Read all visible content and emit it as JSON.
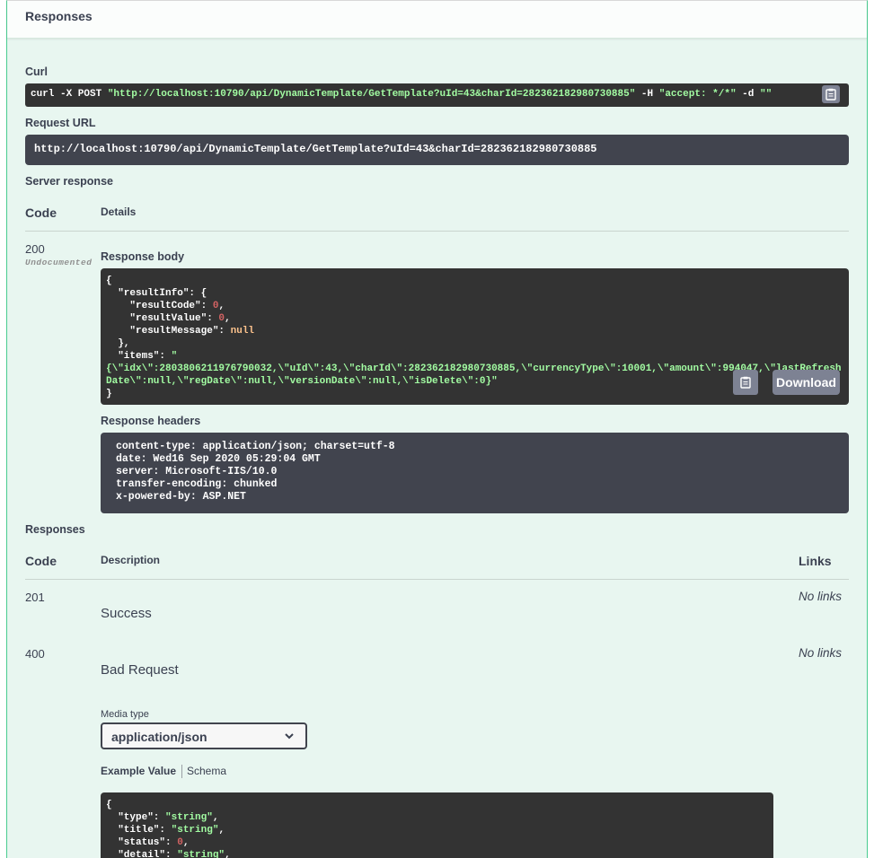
{
  "section_title": "Responses",
  "curl": {
    "label": "Curl",
    "cmd_prefix": "curl -X POST ",
    "cmd_url": "\"http://localhost:10790/api/DynamicTemplate/GetTemplate?uId=43&charId=282362182980730885\"",
    "cmd_mid": " -H  ",
    "cmd_header": "\"accept: */*\"",
    "cmd_data_flag": " -d ",
    "cmd_data": "\"\""
  },
  "request_url": {
    "label": "Request URL",
    "value": "http://localhost:10790/api/DynamicTemplate/GetTemplate?uId=43&charId=282362182980730885"
  },
  "server_response": {
    "label": "Server response",
    "col_code": "Code",
    "col_details": "Details",
    "code": "200",
    "undocumented": "Undocumented",
    "body_label": "Response body",
    "body": {
      "open": "{",
      "resultInfo_key": "  \"resultInfo\": {",
      "resultCode_key": "    \"resultCode\": ",
      "resultCode_val": "0",
      "resultValue_key": "    \"resultValue\": ",
      "resultValue_val": "0",
      "resultMessage_key": "    \"resultMessage\": ",
      "resultMessage_val": "null",
      "resultInfo_close": "  },",
      "items_key": "  \"items\": ",
      "items_q": "\"",
      "items_line1": "{\\\"idx\\\":280380621197679003​2,\\\"uId\\\":43,\\\"charId\\\":282362182980730885,\\\"currencyType\\\":10001,\\\"amount\\\":994047,\\\"lastRefresh",
      "items_line2": "Date\\\":null,\\\"regDate\\\":null,\\\"versionDate\\\":null,\\\"isDelete\\\":0}\"",
      "close": "}"
    },
    "download_label": "Download",
    "headers_label": "Response headers",
    "headers": [
      "content-type: application/json; charset=utf-8",
      "date: Wed16 Sep 2020 05:29:04 GMT",
      "server: Microsoft-IIS/10.0",
      "transfer-encoding: chunked",
      "x-powered-by: ASP.NET"
    ]
  },
  "responses": {
    "label": "Responses",
    "col_code": "Code",
    "col_description": "Description",
    "col_links": "Links",
    "rows": [
      {
        "code": "201",
        "description": "Success",
        "links": "No links"
      },
      {
        "code": "400",
        "description": "Bad Request",
        "links": "No links"
      }
    ],
    "media_type_label": "Media type",
    "media_type_value": "application/json",
    "tab_example": "Example Value",
    "tab_schema": "Schema",
    "example": {
      "open": "{",
      "type_key": "  \"type\": ",
      "type_val": "\"string\"",
      "title_key": "  \"title\": ",
      "title_val": "\"string\"",
      "status_key": "  \"status\": ",
      "status_val": "0",
      "detail_key": "  \"detail\": ",
      "detail_val": "\"string\""
    }
  },
  "icons": [
    "copy-icon",
    "chevron-down-icon"
  ],
  "colors": {
    "accent_green": "#49cc90",
    "panel_bg": "#e8f6f0",
    "code_bg": "#333333",
    "url_bg": "#41444e",
    "string_green": "#a2fca2",
    "number_red": "#d36363",
    "null_orange": "#fcc28c"
  }
}
